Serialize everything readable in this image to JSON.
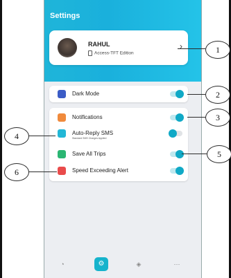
{
  "screen": {
    "title": "Settings"
  },
  "profile": {
    "name": "RAHUL",
    "edition": "Access-TFT Edition",
    "chevron": "›"
  },
  "settings": [
    {
      "label": "Dark Mode",
      "icon": "moon-icon",
      "icon_color": "#3b5cc6",
      "toggle_on": true
    },
    {
      "label": "Notifications",
      "icon": "bell-icon",
      "icon_color": "#f08a3c",
      "toggle_on": true
    },
    {
      "label": "Auto-Reply SMS",
      "sub": "Standard SMS Charges Applied",
      "icon": "message-icon",
      "icon_color": "#22b7d6",
      "toggle_on": true
    },
    {
      "label": "Save All Trips",
      "icon": "trash-icon",
      "icon_color": "#2bb673",
      "toggle_on": true
    },
    {
      "label": "Speed Exceeding Alert",
      "icon": "speed-alert-icon",
      "icon_color": "#e94b4b",
      "toggle_on": true
    }
  ],
  "callouts": [
    "1",
    "2",
    "3",
    "4",
    "5",
    "6"
  ],
  "nav": {
    "items": [
      "speedometer-icon",
      "settings-icon",
      "navigation-icon",
      "more-icon"
    ]
  },
  "colors": {
    "accent": "#16b3cc",
    "header_gradient": [
      "#1fb5d9",
      "#24c3e8"
    ]
  }
}
